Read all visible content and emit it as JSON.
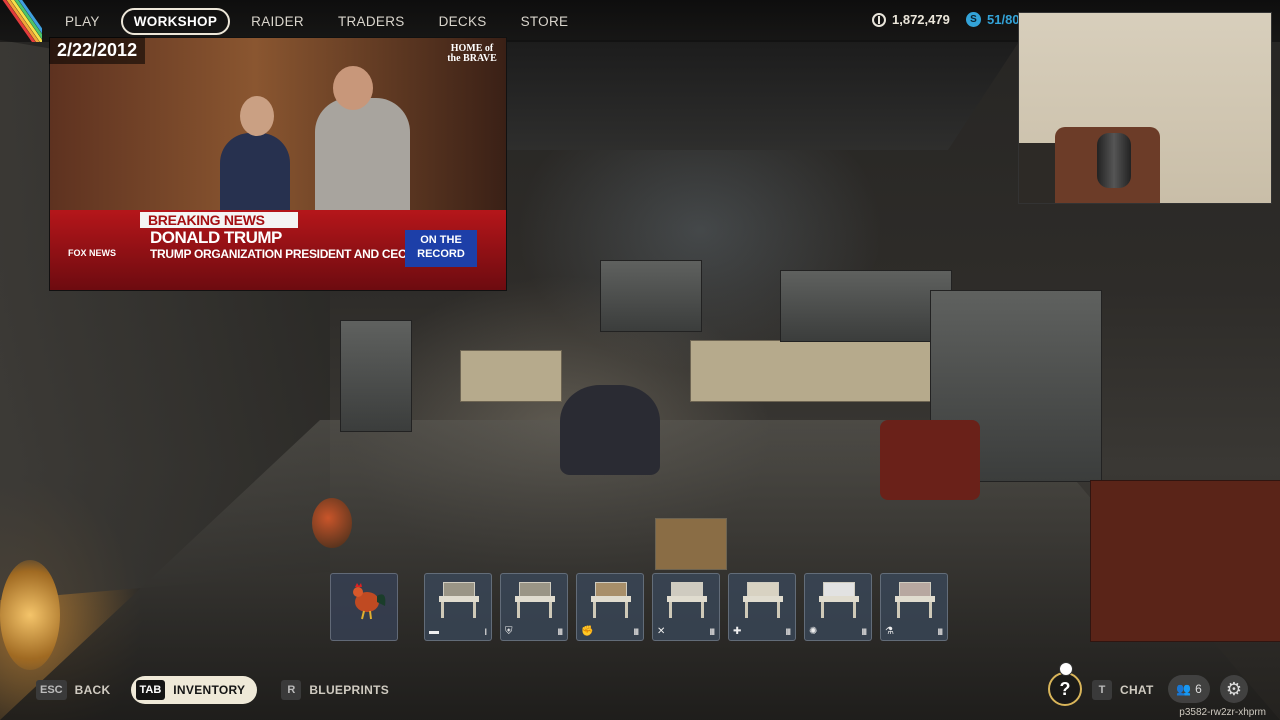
{
  "nav": {
    "items": [
      "PLAY",
      "WORKSHOP",
      "RAIDER",
      "TRADERS",
      "DECKS",
      "STORE"
    ],
    "active": "WORKSHOP"
  },
  "currency": {
    "coins_value": "1,872,479",
    "coins_icon": "coins-icon",
    "creds_value": "51/80",
    "creds_icon": "raider-tokens-icon",
    "creds_color": "#33a3d8"
  },
  "video_overlay": {
    "date": "2/22/2012",
    "logo": "HOME of the BRAVE",
    "ticker_label": "BREAKING NEWS",
    "headline": "DONALD TRUMP",
    "subline": "TRUMP ORGANIZATION PRESIDENT AND CEO",
    "record_badge_line1": "ON THE",
    "record_badge_line2": "RECORD",
    "network": "FOX NEWS"
  },
  "hotbar": {
    "slots": [
      {
        "name": "rooster",
        "icon": "rooster-icon",
        "type_icon": "",
        "tier": ""
      },
      {
        "name": "workbench",
        "icon": "workbench-icon",
        "type_icon": "bench-icon",
        "tier": "I"
      },
      {
        "name": "gunsmith",
        "icon": "workbench-icon",
        "type_icon": "shield-icon",
        "tier": "III"
      },
      {
        "name": "gear-bench",
        "icon": "workbench-icon",
        "type_icon": "fist-icon",
        "tier": "III"
      },
      {
        "name": "weapon-bench",
        "icon": "workbench-icon",
        "type_icon": "crossed-tools-icon",
        "tier": "III"
      },
      {
        "name": "medical-lab",
        "icon": "workbench-icon",
        "type_icon": "plus-icon",
        "tier": "III"
      },
      {
        "name": "explosives-station",
        "icon": "workbench-icon",
        "type_icon": "explosive-icon",
        "tier": "III"
      },
      {
        "name": "refiner",
        "icon": "workbench-icon",
        "type_icon": "flask-icon",
        "tier": "III"
      }
    ]
  },
  "bottom_bar": {
    "back_key": "ESC",
    "back_label": "BACK",
    "inventory_key": "TAB",
    "inventory_label": "INVENTORY",
    "blueprints_key": "R",
    "blueprints_label": "BLUEPRINTS",
    "help_label": "?",
    "chat_key": "T",
    "chat_label": "CHAT",
    "party_count": "6",
    "session_id": "p3582-rw2zr-xhprm"
  }
}
